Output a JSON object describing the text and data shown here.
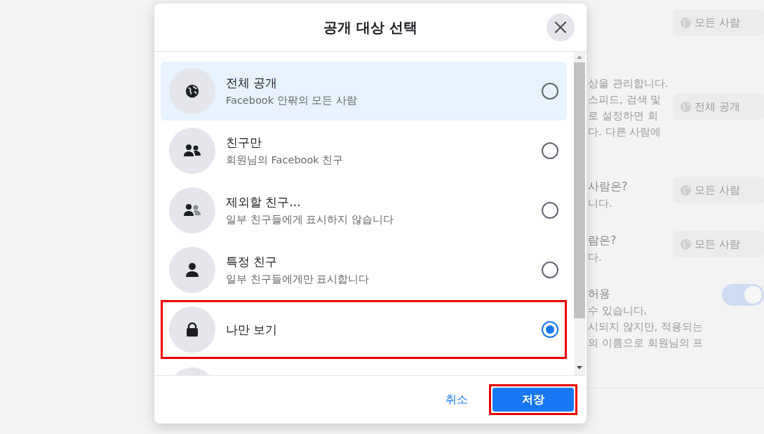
{
  "background": {
    "sections": [
      {
        "button": "모든 사람"
      },
      {
        "lines": [
          "상을 관리합니다.",
          "스피드, 검색 및",
          "로 설정하면 회",
          "다. 다른 사람에"
        ],
        "button": "전체 공개"
      },
      {
        "heading": "사람은?",
        "lines": [
          "니다."
        ],
        "button": "모든 사람"
      },
      {
        "heading": "람은?",
        "lines": [
          "다."
        ],
        "button": "모든 사람"
      },
      {
        "heading": "허용",
        "lines": [
          "수 있습니다.",
          "시되지 않지만, 적용되는",
          "의 이름으로 회원님의 프"
        ],
        "toggle": {
          "on": true
        }
      }
    ]
  },
  "dialog": {
    "title": "공개 대상 선택",
    "options": [
      {
        "kind": "public",
        "title": "전체 공개",
        "subtitle": "Facebook 안팎의 모든 사람",
        "selected": false,
        "hovered": true,
        "annotated": false
      },
      {
        "kind": "friends",
        "title": "친구만",
        "subtitle": "회원님의 Facebook 친구",
        "selected": false,
        "hovered": false,
        "annotated": false
      },
      {
        "kind": "except",
        "title": "제외할 친구...",
        "subtitle": "일부 친구들에게 표시하지 않습니다",
        "selected": false,
        "hovered": false,
        "annotated": false
      },
      {
        "kind": "specific",
        "title": "특정 친구",
        "subtitle": "일부 친구들에게만 표시합니다",
        "selected": false,
        "hovered": false,
        "annotated": false
      },
      {
        "kind": "onlyme",
        "title": "나만 보기",
        "selected": true,
        "hovered": false,
        "annotated": true
      }
    ],
    "cancel": "취소",
    "save": {
      "label": "저장",
      "annotated": true
    }
  }
}
